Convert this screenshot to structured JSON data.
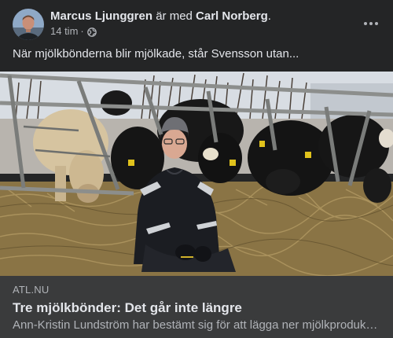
{
  "post": {
    "author": "Marcus Ljunggren",
    "with_text": "är med",
    "tagged": "Carl Norberg",
    "period": ".",
    "time": "14 tim",
    "dot": "·",
    "audience_icon": "globe-icon",
    "more_icon": "more-options-icon",
    "text": "När mjölkbönderna blir mjölkade, står Svensson utan..."
  },
  "link": {
    "domain": "ATL.NU",
    "title": "Tre mjölkbönder: Det går inte längre",
    "description": "Ann-Kristin Lundström har bestämt sig för att lägga ner mjölkproduktion"
  },
  "colors": {
    "background": "#242526",
    "link_box": "#3a3b3c",
    "primary_text": "#e4e6eb",
    "secondary_text": "#b0b3b8"
  }
}
